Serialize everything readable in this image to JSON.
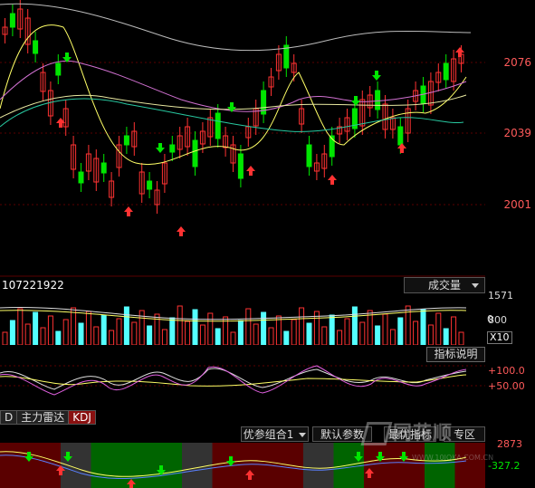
{
  "main_chart": {
    "price_labels": [
      "2076",
      "2039",
      "2001"
    ],
    "label_color": "#ff5a5a"
  },
  "volume": {
    "value_text": "107221922",
    "dropdown_label": "成交量",
    "axis_labels": [
      "1571",
      "800",
      "0"
    ],
    "unit_label": "X10"
  },
  "kdj_panel": {
    "indicator_button": "指标说明",
    "axis_labels": [
      "+100.0",
      "+50.00"
    ]
  },
  "tabs": [
    {
      "label": "D",
      "active": false
    },
    {
      "label": "主力雷达",
      "active": false
    },
    {
      "label": "KDJ",
      "active": true
    }
  ],
  "bottom_controls": {
    "combo_label": "优参组合1",
    "default_params": "默认参数",
    "best_indicator": "最优指标",
    "zone_label": "专区"
  },
  "bottom_panel": {
    "axis_labels": [
      "2873",
      "-327.2"
    ]
  },
  "watermark": {
    "brand": "同花顺",
    "site": "WWW.10JQKA.COM.CN"
  },
  "colors": {
    "up": "#ff3232",
    "down": "#00e600",
    "volume_bar": "#54ffff",
    "grid": "#5a0000"
  }
}
